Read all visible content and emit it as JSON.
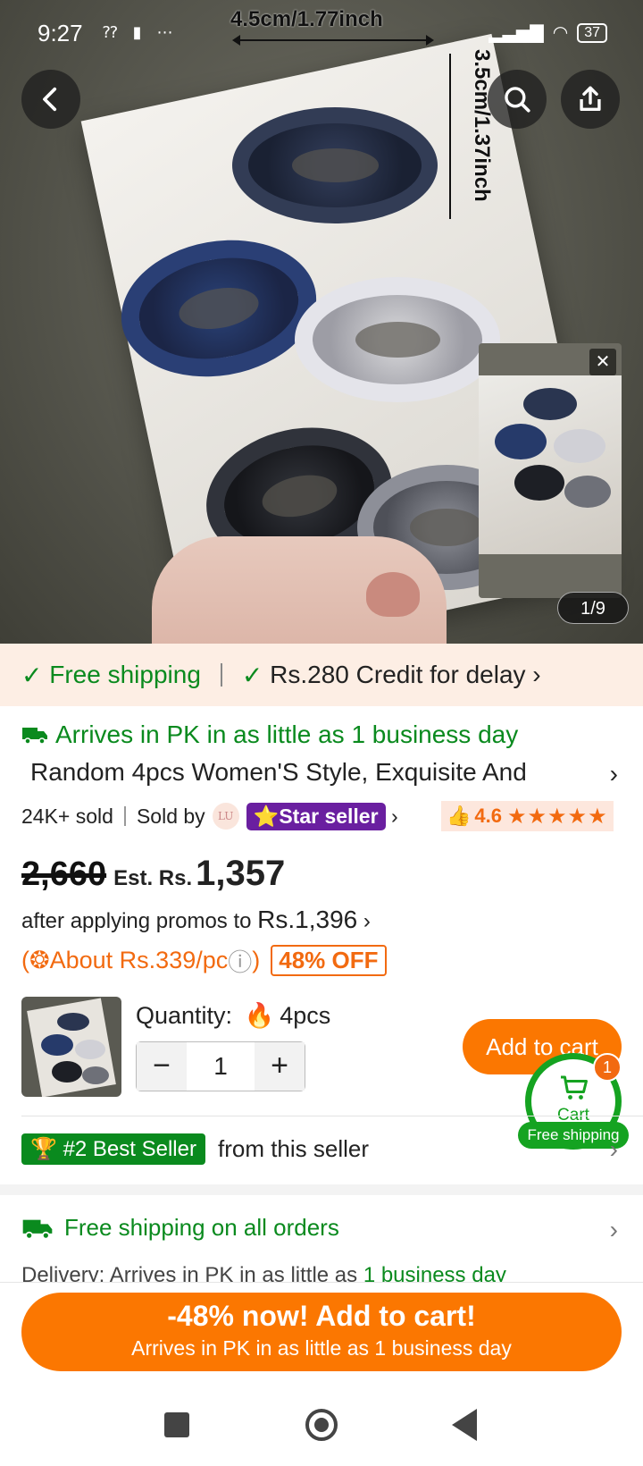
{
  "status_bar": {
    "time": "9:27",
    "left_icons": "⁇ ▮ ⋯",
    "battery": "37"
  },
  "image_overlay": {
    "width_label": "4.5cm/1.77inch",
    "height_label": "3.5cm/1.37inch",
    "counter": "1/9"
  },
  "header_icons": [
    "back-arrow-icon",
    "search-icon",
    "share-icon"
  ],
  "shipping_bar": {
    "free_shipping": "Free shipping",
    "credit": "Rs.280 Credit for delay"
  },
  "arrival": "Arrives in PK in as little as 1 business day",
  "product": {
    "title": "Random 4pcs Women'S Style, Exquisite And",
    "sold": "24K+ sold",
    "sold_by": "Sold by",
    "seller_logo": "LU",
    "star_seller": "Star seller",
    "rating": "4.6",
    "rating_stars": "★★★★★"
  },
  "pricing": {
    "old_price": "2,660",
    "est_label": "Est. Rs.",
    "est_price": "1,357",
    "promo_text": "after applying promos to ",
    "promo_price": "Rs.1,396",
    "about_per_pc": "About Rs.339/pc",
    "discount": "48% OFF"
  },
  "quantity": {
    "label": "Quantity:",
    "pack": "4pcs",
    "value": "1",
    "minus": "−",
    "plus": "+"
  },
  "add_to_cart": "Add to cart",
  "cart_fab": {
    "label": "Cart",
    "count": "1",
    "free_shipping": "Free shipping"
  },
  "best_seller": {
    "badge": "#2 Best Seller",
    "text": "from this seller"
  },
  "free_shipping_all": "Free shipping on all orders",
  "delivery": {
    "label": "Delivery:",
    "text": "Arrives in PK in as little as ",
    "highlight": "1 business day"
  },
  "cta": {
    "line1": "-48% now! Add to cart!",
    "line2": "Arrives in PK in as little as 1 business day"
  },
  "colors": {
    "orange": "#fb7701",
    "green": "#0a8a1e",
    "purple": "#6a1fa0",
    "peach": "#fdeee4"
  }
}
